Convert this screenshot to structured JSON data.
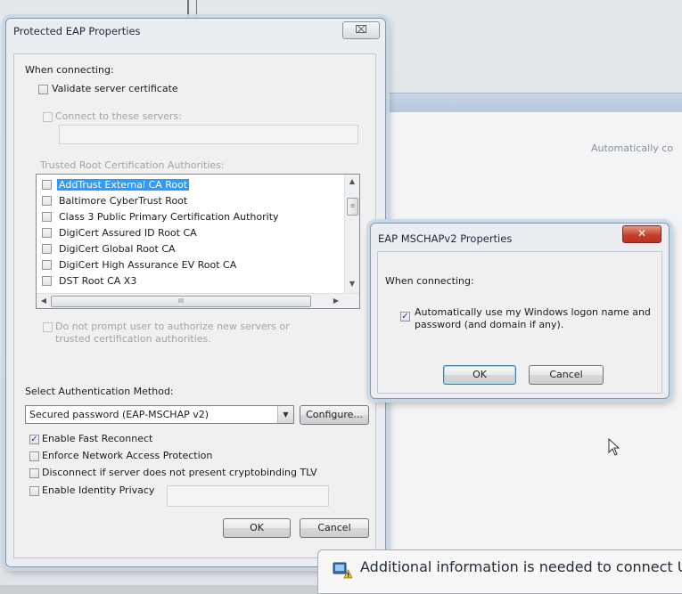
{
  "background": {
    "status_text": "Automatically co"
  },
  "peap": {
    "title": "Protected EAP Properties",
    "close_glyph": "⌧",
    "when_connecting": "When connecting:",
    "validate_cert": {
      "label": "Validate server certificate",
      "checked": false
    },
    "connect_servers": {
      "label": "Connect to these servers:",
      "checked": false,
      "value": ""
    },
    "trusted_ca_label": "Trusted Root Certification Authorities:",
    "ca_list": [
      {
        "label": "AddTrust External CA Root",
        "checked": false,
        "selected": true
      },
      {
        "label": "Baltimore CyberTrust Root",
        "checked": false,
        "selected": false
      },
      {
        "label": "Class 3 Public Primary Certification Authority",
        "checked": false,
        "selected": false
      },
      {
        "label": "DigiCert Assured ID Root CA",
        "checked": false,
        "selected": false
      },
      {
        "label": "DigiCert Global Root CA",
        "checked": false,
        "selected": false
      },
      {
        "label": "DigiCert High Assurance EV Root CA",
        "checked": false,
        "selected": false
      },
      {
        "label": "DST Root CA X3",
        "checked": false,
        "selected": false
      }
    ],
    "scroll_up": "▲",
    "scroll_down": "▼",
    "scroll_left": "◀",
    "scroll_right": "▶",
    "thumb_grip": "≡",
    "hthumb_grip": "III",
    "do_not_prompt": "Do not prompt user to authorize new servers or trusted certification authorities.",
    "auth_method_label": "Select Authentication Method:",
    "auth_method_value": "Secured password (EAP-MSCHAP v2)",
    "configure_label": "Configure...",
    "options": [
      {
        "label": "Enable Fast Reconnect",
        "checked": true
      },
      {
        "label": "Enforce Network Access Protection",
        "checked": false
      },
      {
        "label": "Disconnect if server does not present cryptobinding TLV",
        "checked": false
      },
      {
        "label": "Enable Identity Privacy",
        "checked": false
      }
    ],
    "identity_value": "",
    "ok_label": "OK",
    "cancel_label": "Cancel"
  },
  "mschap": {
    "title": "EAP MSCHAPv2 Properties",
    "close_glyph": "✕",
    "when_connecting": "When connecting:",
    "auto_logon_line1": "Automatically use my Windows logon name and",
    "auto_logon_line2": "password (and domain if any).",
    "auto_logon_checked": true,
    "ok_label": "OK",
    "cancel_label": "Cancel"
  },
  "notification": {
    "text": "Additional information is needed to connect U",
    "icon": "network-warning-icon"
  },
  "check_glyph": "✓",
  "colors": {
    "selection": "#3399ff",
    "close_red": "#c6412b",
    "dialog_bg": "#eaeef2"
  }
}
